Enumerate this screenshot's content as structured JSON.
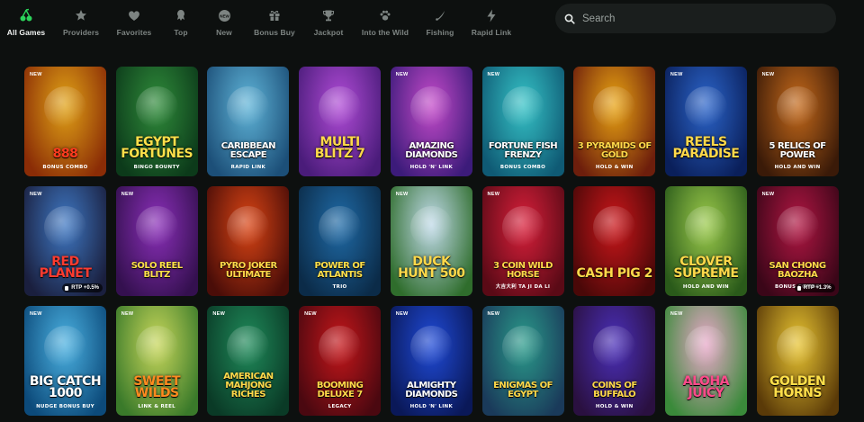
{
  "nav": {
    "items": [
      {
        "label": "All Games",
        "icon": "cherry-icon",
        "active": true
      },
      {
        "label": "Providers",
        "icon": "star-icon",
        "active": false
      },
      {
        "label": "Favorites",
        "icon": "heart-icon",
        "active": false
      },
      {
        "label": "Top",
        "icon": "top-icon",
        "active": false
      },
      {
        "label": "New",
        "icon": "new-icon",
        "active": false
      },
      {
        "label": "Bonus Buy",
        "icon": "gift-icon",
        "active": false
      },
      {
        "label": "Jackpot",
        "icon": "trophy-icon",
        "active": false
      },
      {
        "label": "Into the Wild",
        "icon": "paw-icon",
        "active": false
      },
      {
        "label": "Fishing",
        "icon": "fishing-icon",
        "active": false
      },
      {
        "label": "Rapid Link",
        "icon": "lightning-icon",
        "active": false
      }
    ]
  },
  "search": {
    "placeholder": "Search",
    "value": ""
  },
  "games": [
    {
      "title": "888",
      "subtitle": "Bonus Combo",
      "badge": "NEW",
      "rtp": "",
      "bg": [
        "#e0a216",
        "#8a2c06"
      ],
      "title_color": "#ff3b1f"
    },
    {
      "title": "Egypt Fortunes",
      "subtitle": "Bingo Bounty",
      "badge": "",
      "rtp": "",
      "bg": [
        "#2f8b3a",
        "#0c3a1a"
      ],
      "title_color": "#ffe04a"
    },
    {
      "title": "Caribbean Escape",
      "subtitle": "Rapid Link",
      "badge": "",
      "rtp": "",
      "bg": [
        "#5fb4d8",
        "#1c4f78"
      ],
      "title_color": "#ffffff"
    },
    {
      "title": "Multi Blitz 7",
      "subtitle": "",
      "badge": "",
      "rtp": "",
      "bg": [
        "#b04bd6",
        "#4a1c7a"
      ],
      "title_color": "#ffd94a"
    },
    {
      "title": "Amazing Diamonds",
      "subtitle": "Hold 'n' Link",
      "badge": "NEW",
      "rtp": "",
      "bg": [
        "#c44ac9",
        "#3c1b7a"
      ],
      "title_color": "#ffffff"
    },
    {
      "title": "Fortune Fish Frenzy",
      "subtitle": "Bonus Combo",
      "badge": "NEW",
      "rtp": "",
      "bg": [
        "#35c2c6",
        "#0f5a74"
      ],
      "title_color": "#ffffff"
    },
    {
      "title": "3 Pyramids of Gold",
      "subtitle": "Hold & Win",
      "badge": "",
      "rtp": "",
      "bg": [
        "#e8a312",
        "#6d1e0c"
      ],
      "title_color": "#ffd94a"
    },
    {
      "title": "Reels Paradise",
      "subtitle": "",
      "badge": "NEW",
      "rtp": "",
      "bg": [
        "#2b64c9",
        "#0a1f5a"
      ],
      "title_color": "#ffd94a"
    },
    {
      "title": "5 Relics of Power",
      "subtitle": "Hold and Win",
      "badge": "NEW",
      "rtp": "",
      "bg": [
        "#c4691a",
        "#3a1a08"
      ],
      "title_color": "#ffffff"
    },
    {
      "title": "Red Planet",
      "subtitle": "",
      "badge": "NEW",
      "rtp": "RTP +0.5%",
      "bg": [
        "#3e77c2",
        "#1a1f3e"
      ],
      "title_color": "#ff3b2f"
    },
    {
      "title": "Solo Reel Blitz",
      "subtitle": "",
      "badge": "NEW",
      "rtp": "",
      "bg": [
        "#8a2fb8",
        "#34104f"
      ],
      "title_color": "#ffe04a"
    },
    {
      "title": "Pyro Joker Ultimate",
      "subtitle": "",
      "badge": "",
      "rtp": "",
      "bg": [
        "#d94414",
        "#4a0d08"
      ],
      "title_color": "#ffd94a"
    },
    {
      "title": "Power of Atlantis",
      "subtitle": "Trio",
      "badge": "",
      "rtp": "",
      "bg": [
        "#1f6aa6",
        "#0b2b48"
      ],
      "title_color": "#ffe04a"
    },
    {
      "title": "Duck Hunt 500",
      "subtitle": "",
      "badge": "NEW",
      "rtp": "",
      "bg": [
        "#bfd9e8",
        "#2f6d2c"
      ],
      "title_color": "#ffd94a"
    },
    {
      "title": "3 Coin Wild Horse",
      "subtitle": "大吉大利 Ta Ji Da Li",
      "badge": "NEW",
      "rtp": "",
      "bg": [
        "#d81f3a",
        "#5a0a16"
      ],
      "title_color": "#ffd94a"
    },
    {
      "title": "Cash Pig 2",
      "subtitle": "",
      "badge": "",
      "rtp": "",
      "bg": [
        "#c9161a",
        "#4a0808"
      ],
      "title_color": "#ffd94a"
    },
    {
      "title": "Clover Supreme",
      "subtitle": "Hold and Win",
      "badge": "",
      "rtp": "",
      "bg": [
        "#9ac94a",
        "#2a5a1a"
      ],
      "title_color": "#ffd94a"
    },
    {
      "title": "San Chong Baozha",
      "subtitle": "Bonus Combo",
      "badge": "NEW",
      "rtp": "RTP +1.3%",
      "bg": [
        "#b01642",
        "#3a0618"
      ],
      "title_color": "#ffd94a"
    },
    {
      "title": "Big Catch 1000",
      "subtitle": "Nudge Bonus Buy",
      "badge": "NEW",
      "rtp": "",
      "bg": [
        "#4ab0e0",
        "#0c4a7a"
      ],
      "title_color": "#ffffff"
    },
    {
      "title": "Sweet Wilds",
      "subtitle": "Link & Reel",
      "badge": "NEW",
      "rtp": "",
      "bg": [
        "#c7d65a",
        "#3a7a2a"
      ],
      "title_color": "#ff8a1f"
    },
    {
      "title": "American Mahjong Riches",
      "subtitle": "",
      "badge": "NEW",
      "rtp": "",
      "bg": [
        "#1f8a5a",
        "#0a3a26"
      ],
      "title_color": "#ffd94a"
    },
    {
      "title": "Booming Deluxe 7",
      "subtitle": "Legacy",
      "badge": "NEW",
      "rtp": "",
      "bg": [
        "#c4161a",
        "#4a0810"
      ],
      "title_color": "#ffd94a"
    },
    {
      "title": "Almighty Diamonds",
      "subtitle": "Hold 'n' Link",
      "badge": "NEW",
      "rtp": "",
      "bg": [
        "#1f4ad6",
        "#0a1858"
      ],
      "title_color": "#ffffff"
    },
    {
      "title": "Enigmas of Egypt",
      "subtitle": "",
      "badge": "NEW",
      "rtp": "",
      "bg": [
        "#2a9a8a",
        "#1a3a5a"
      ],
      "title_color": "#ffd94a"
    },
    {
      "title": "Coins of Buffalo",
      "subtitle": "Hold & Win",
      "badge": "",
      "rtp": "",
      "bg": [
        "#4a2fb8",
        "#2a1040"
      ],
      "title_color": "#ffd94a"
    },
    {
      "title": "Aloha Juicy",
      "subtitle": "",
      "badge": "NEW",
      "rtp": "",
      "bg": [
        "#e8a7c8",
        "#3a8a3a"
      ],
      "title_color": "#ff4a8a"
    },
    {
      "title": "Golden Horns",
      "subtitle": "",
      "badge": "",
      "rtp": "",
      "bg": [
        "#e8c431",
        "#5a3a08"
      ],
      "title_color": "#ffe04a"
    }
  ]
}
